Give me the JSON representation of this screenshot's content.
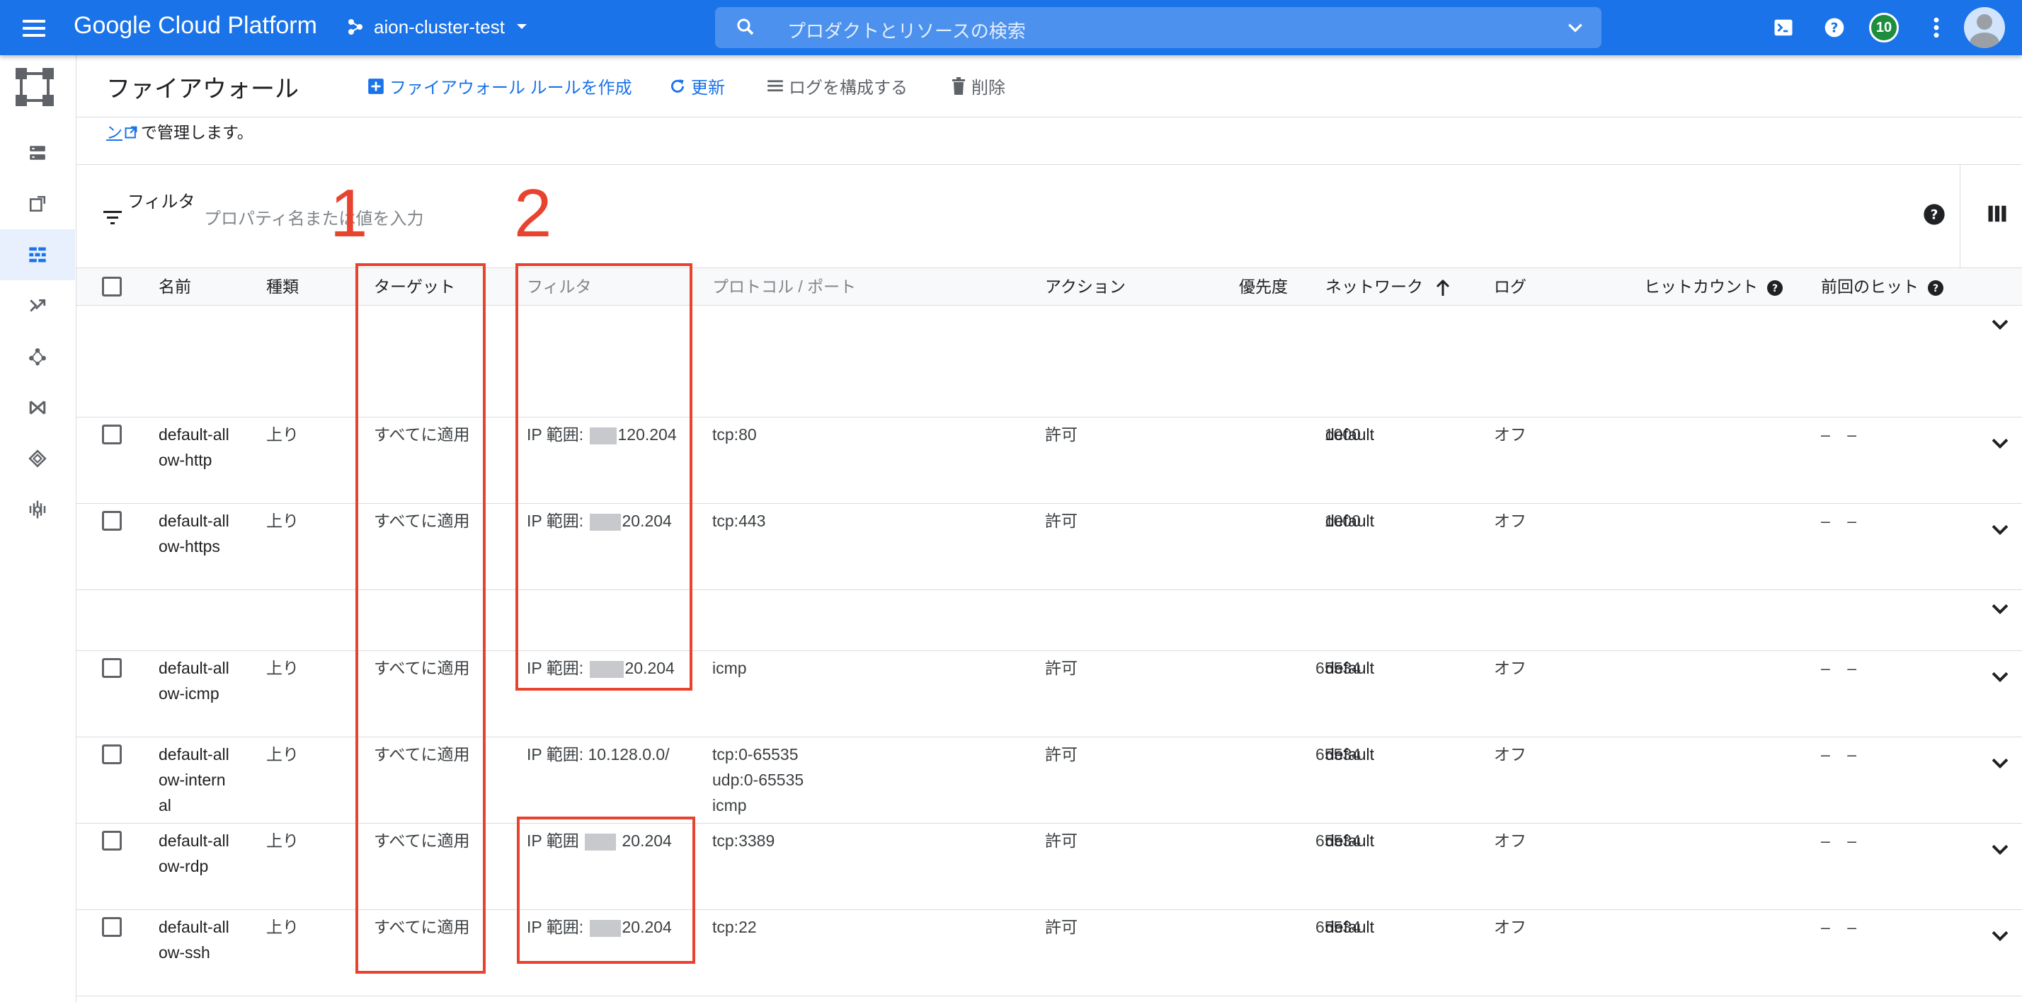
{
  "topbar": {
    "brand": "Google Cloud Platform",
    "project": "aion-cluster-test",
    "search_placeholder": "プロダクトとリソースの検索",
    "notifications_count": "10",
    "icons": [
      "menu-icon",
      "project-icon",
      "search-icon",
      "chevron-down-icon",
      "cloud-shell-icon",
      "help-icon",
      "more-vert-icon",
      "account-avatar"
    ],
    "accent_color": "#1a73e8"
  },
  "sidebar": {
    "icons": [
      "vpc-network-icon",
      "ip-addresses-icon",
      "external-ip-icon",
      "firewall-icon",
      "routes-icon",
      "peering-icon",
      "shared-vpc-icon",
      "serverless-connector-icon",
      "packet-mirroring-icon"
    ],
    "active": "firewall-icon"
  },
  "header": {
    "title": "ファイアウォール",
    "create_label": "ファイアウォール ルールを作成",
    "refresh_label": "更新",
    "configure_logs_label": "ログを構成する",
    "delete_label": "削除"
  },
  "note": {
    "link_tail": "ン",
    "text": "で管理します。"
  },
  "filter": {
    "label": "フィルタ",
    "placeholder": "プロパティ名または値を入力"
  },
  "table": {
    "columns": [
      "名前",
      "種類",
      "ターゲット",
      "フィルタ",
      "プロトコル / ポート",
      "アクション",
      "優先度",
      "ネットワーク",
      "ログ",
      "ヒットカウント",
      "前回のヒット"
    ],
    "sorted_column": "ネットワーク",
    "sort_direction": "ascending",
    "rows": [
      {
        "name": "default-allow-http",
        "type": "上り",
        "target": "すべてに適用",
        "filter_prefix": "IP 範囲:",
        "filter_suffix": "120.204",
        "protocol": "tcp:80",
        "action": "許可",
        "priority": "1000",
        "network": "default",
        "log": "オフ",
        "hits": "–",
        "last_hit": "–"
      },
      {
        "name": "default-allow-https",
        "type": "上り",
        "target": "すべてに適用",
        "filter_prefix": "IP 範囲:",
        "filter_suffix": "20.204",
        "protocol": "tcp:443",
        "action": "許可",
        "priority": "1000",
        "network": "default",
        "log": "オフ",
        "hits": "–",
        "last_hit": "–"
      },
      {
        "name": "default-allow-icmp",
        "type": "上り",
        "target": "すべてに適用",
        "filter_prefix": "IP 範囲:",
        "filter_suffix": "20.204",
        "protocol": "icmp",
        "action": "許可",
        "priority": "65534",
        "network": "default",
        "log": "オフ",
        "hits": "–",
        "last_hit": "–"
      },
      {
        "name": "default-allow-internal",
        "type": "上り",
        "target": "すべてに適用",
        "filter_prefix": "IP 範囲: 10.128.0.0/",
        "filter_suffix": "",
        "protocol": "tcp:0-65535",
        "protocol2": "udp:0-65535",
        "protocol3": "icmp",
        "action": "許可",
        "priority": "65534",
        "network": "default",
        "log": "オフ",
        "hits": "–",
        "last_hit": "–"
      },
      {
        "name": "default-allow-rdp",
        "type": "上り",
        "target": "すべてに適用",
        "filter_prefix": "IP 範囲",
        "filter_suffix": "20.204",
        "protocol": "tcp:3389",
        "action": "許可",
        "priority": "65534",
        "network": "default",
        "log": "オフ",
        "hits": "–",
        "last_hit": "–"
      },
      {
        "name": "default-allow-ssh",
        "type": "上り",
        "target": "すべてに適用",
        "filter_prefix": "IP 範囲:",
        "filter_suffix": "20.204",
        "protocol": "tcp:22",
        "action": "許可",
        "priority": "65534",
        "network": "default",
        "log": "オフ",
        "hits": "–",
        "last_hit": "–"
      }
    ]
  },
  "annotations": {
    "label1": "1",
    "label2": "2",
    "color": "#e8432f"
  }
}
